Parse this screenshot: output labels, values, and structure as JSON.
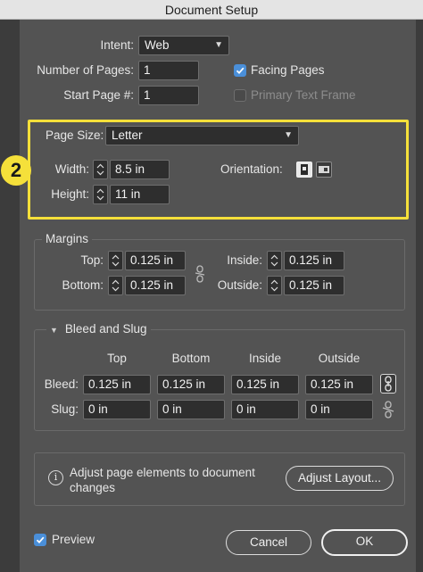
{
  "window": {
    "title": "Document Setup"
  },
  "intent": {
    "label": "Intent:",
    "value": "Web"
  },
  "num_pages": {
    "label": "Number of Pages:",
    "value": "1"
  },
  "start_page": {
    "label": "Start Page #:",
    "value": "1"
  },
  "facing_pages": {
    "label": "Facing Pages",
    "checked": true
  },
  "primary_text_frame": {
    "label": "Primary Text Frame",
    "checked": false
  },
  "callout": {
    "number": "2",
    "color": "#f5e03a"
  },
  "page_size": {
    "label": "Page Size:",
    "value": "Letter",
    "width_label": "Width:",
    "width_value": "8.5 in",
    "height_label": "Height:",
    "height_value": "11 in",
    "orientation_label": "Orientation:"
  },
  "margins": {
    "legend": "Margins",
    "top_label": "Top:",
    "top_value": "0.125 in",
    "bottom_label": "Bottom:",
    "bottom_value": "0.125 in",
    "inside_label": "Inside:",
    "inside_value": "0.125 in",
    "outside_label": "Outside:",
    "outside_value": "0.125 in"
  },
  "bleed_slug": {
    "legend": "Bleed and Slug",
    "columns": [
      "Top",
      "Bottom",
      "Inside",
      "Outside"
    ],
    "bleed_label": "Bleed:",
    "bleed_values": [
      "0.125 in",
      "0.125 in",
      "0.125 in",
      "0.125 in"
    ],
    "slug_label": "Slug:",
    "slug_values": [
      "0 in",
      "0 in",
      "0 in",
      "0 in"
    ]
  },
  "adjust": {
    "line1": "Adjust page elements to document",
    "line2": "changes",
    "button": "Adjust Layout..."
  },
  "preview": {
    "label": "Preview",
    "checked": true
  },
  "buttons": {
    "cancel": "Cancel",
    "ok": "OK"
  },
  "colors": {
    "dialog_bg": "#535353",
    "field_bg": "#2e2e2e",
    "checkbox_blue": "#4a8fd9",
    "highlight": "#f5e03a"
  }
}
